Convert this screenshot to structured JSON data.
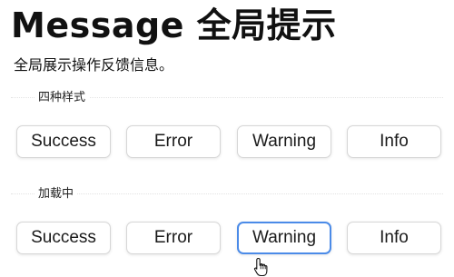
{
  "page": {
    "title": "Message 全局提示",
    "description": "全局展示操作反馈信息。"
  },
  "sections": [
    {
      "title": "四种样式",
      "buttons": [
        "Success",
        "Error",
        "Warning",
        "Info"
      ]
    },
    {
      "title": "加载中",
      "buttons": [
        "Success",
        "Error",
        "Warning",
        "Info"
      ],
      "active_button": "Warning"
    }
  ],
  "colors": {
    "active_border": "#4b8be8",
    "button_border": "#d6d6d6"
  },
  "icons": {
    "cursor": "hand-pointer-icon"
  }
}
